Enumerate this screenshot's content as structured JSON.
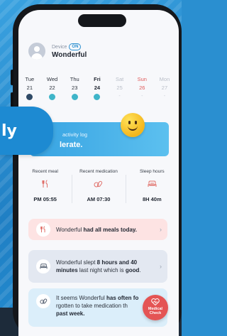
{
  "header": {
    "device_label": "Device",
    "device_status": "ON",
    "user_name": "Wonderful"
  },
  "week": [
    {
      "day": "Tue",
      "date": "21",
      "status": "dark"
    },
    {
      "day": "Wed",
      "date": "22",
      "status": "teal"
    },
    {
      "day": "Thu",
      "date": "23",
      "status": "teal"
    },
    {
      "day": "Fri",
      "date": "24",
      "status": "teal",
      "selected": true
    },
    {
      "day": "Sat",
      "date": "25",
      "status": "-"
    },
    {
      "day": "Sun",
      "date": "26",
      "status": "-"
    },
    {
      "day": "Mon",
      "date": "27",
      "status": "-"
    }
  ],
  "tag": {
    "text": "ly"
  },
  "activity": {
    "line1": "activity log",
    "line2": "lerate."
  },
  "stats": [
    {
      "label": "Recent meal",
      "icon": "utensils-icon",
      "value": "PM 05:55"
    },
    {
      "label": "Recent medication",
      "icon": "pill-icon",
      "value": "AM 07:30"
    },
    {
      "label": "Sleep hours",
      "icon": "bed-icon",
      "value": "8H 40m"
    }
  ],
  "cards": {
    "meal": {
      "pre": "Wonderful ",
      "bold": "had all meals today.",
      "post": ""
    },
    "sleep": {
      "pre": "Wonderful slept ",
      "bold": "8 hours and 40 minutes",
      "post": " last night which is ",
      "bold2": "good",
      "end": "."
    },
    "medication": {
      "pre": "It seems Wonderful ",
      "bold": "has often fo",
      "mid": "rgotten to take medication th",
      "bold2": "past week."
    }
  },
  "fab": {
    "line1": "Medical",
    "line2": "Check"
  },
  "colors": {
    "accent": "#2a8fd0",
    "alert": "#e45454",
    "smiley": "#f4b61c"
  }
}
